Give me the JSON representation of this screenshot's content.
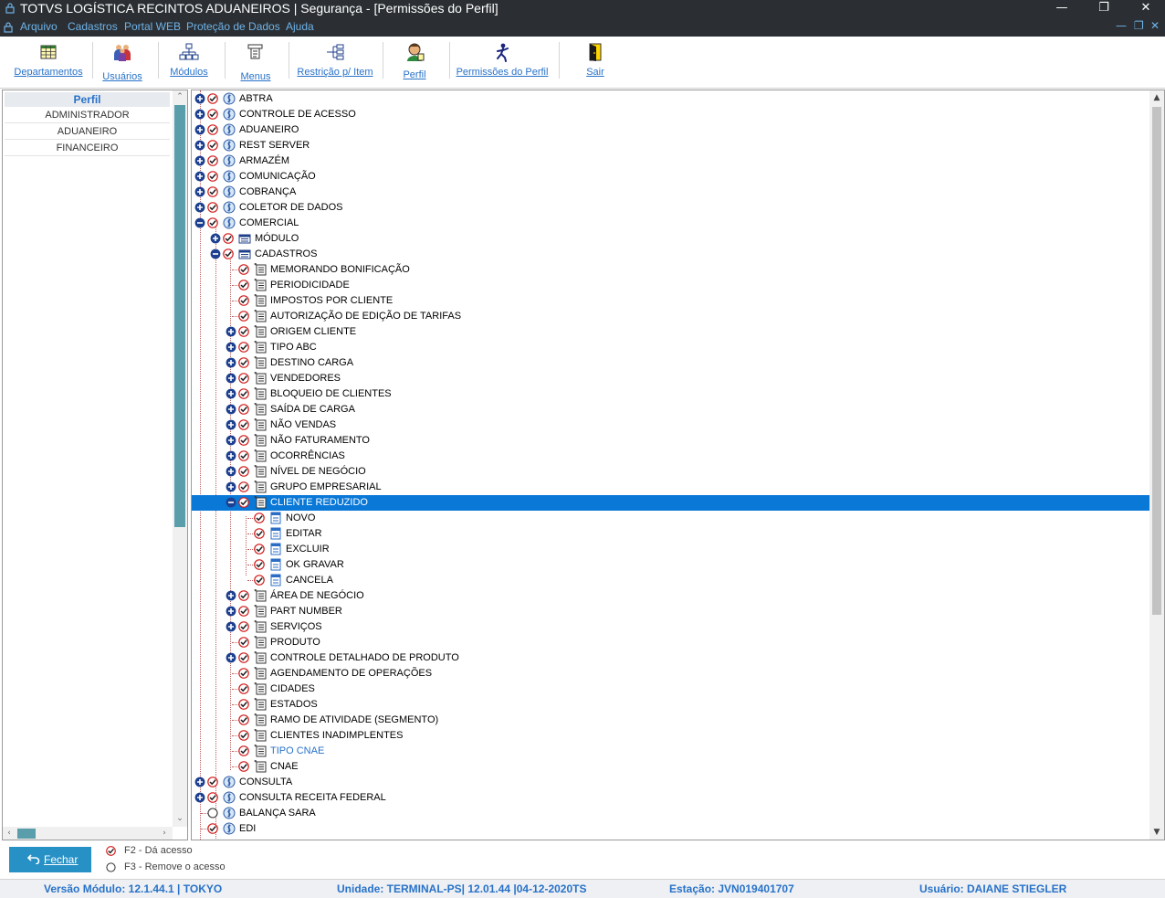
{
  "window": {
    "title": "TOTVS LOGÍSTICA RECINTOS ADUANEIROS | Segurança - [Permissões do Perfil]",
    "minimize": "—",
    "restore": "❐",
    "close": "✕"
  },
  "menu": {
    "items": [
      "Arquivo",
      "Cadastros",
      "Portal WEB",
      "Proteção de Dados",
      "Ajuda"
    ],
    "mdi_minimize": "—",
    "mdi_restore": "❐",
    "mdi_close": "✕"
  },
  "toolbar": {
    "buttons": [
      {
        "label": "Departamentos",
        "icon": "grid-icon"
      },
      {
        "label": "Usuários",
        "icon": "users-icon"
      },
      {
        "label": "Módulos",
        "icon": "hierarchy-icon"
      },
      {
        "label": "Menus",
        "icon": "menu-icon"
      },
      {
        "label": "Restrição p/ Item",
        "icon": "restriction-icon"
      },
      {
        "label": "Perfil",
        "icon": "profile-icon"
      },
      {
        "label": "Permissões do Perfil",
        "icon": "permissions-icon"
      },
      {
        "label": "Sair",
        "icon": "exit-icon"
      }
    ]
  },
  "profiles": {
    "header": "Perfil",
    "items": [
      "ADMINISTRADOR",
      "ADUANEIRO",
      "FINANCEIRO"
    ]
  },
  "tree": {
    "nodes": [
      {
        "label": "ABTRA",
        "level": 0,
        "expander": "plus",
        "check": "checked",
        "icon": "module"
      },
      {
        "label": "CONTROLE DE ACESSO",
        "level": 0,
        "expander": "plus",
        "check": "checked",
        "icon": "module"
      },
      {
        "label": "ADUANEIRO",
        "level": 0,
        "expander": "plus",
        "check": "checked",
        "icon": "module"
      },
      {
        "label": "REST SERVER",
        "level": 0,
        "expander": "plus",
        "check": "checked",
        "icon": "module"
      },
      {
        "label": "ARMAZÉM",
        "level": 0,
        "expander": "plus",
        "check": "checked",
        "icon": "module"
      },
      {
        "label": "COMUNICAÇÃO",
        "level": 0,
        "expander": "plus",
        "check": "checked",
        "icon": "module"
      },
      {
        "label": "COBRANÇA",
        "level": 0,
        "expander": "plus",
        "check": "checked",
        "icon": "module"
      },
      {
        "label": "COLETOR DE DADOS",
        "level": 0,
        "expander": "plus",
        "check": "checked",
        "icon": "module"
      },
      {
        "label": "COMERCIAL",
        "level": 0,
        "expander": "minus",
        "check": "checked",
        "icon": "module"
      },
      {
        "label": "MÓDULO",
        "level": 1,
        "expander": "plus",
        "check": "checked",
        "icon": "folder"
      },
      {
        "label": "CADASTROS",
        "level": 1,
        "expander": "minus",
        "check": "checked",
        "icon": "folder"
      },
      {
        "label": "MEMORANDO BONIFICAÇÃO",
        "level": 2,
        "expander": "none",
        "check": "checked",
        "icon": "form"
      },
      {
        "label": "PERIODICIDADE",
        "level": 2,
        "expander": "none",
        "check": "checked",
        "icon": "form"
      },
      {
        "label": "IMPOSTOS POR CLIENTE",
        "level": 2,
        "expander": "none",
        "check": "checked",
        "icon": "form"
      },
      {
        "label": "AUTORIZAÇÃO DE EDIÇÃO DE TARIFAS",
        "level": 2,
        "expander": "none",
        "check": "checked",
        "icon": "form"
      },
      {
        "label": "ORIGEM CLIENTE",
        "level": 2,
        "expander": "plus",
        "check": "checked",
        "icon": "form"
      },
      {
        "label": "TIPO ABC",
        "level": 2,
        "expander": "plus",
        "check": "checked",
        "icon": "form"
      },
      {
        "label": "DESTINO CARGA",
        "level": 2,
        "expander": "plus",
        "check": "checked",
        "icon": "form"
      },
      {
        "label": "VENDEDORES",
        "level": 2,
        "expander": "plus",
        "check": "checked",
        "icon": "form"
      },
      {
        "label": "BLOQUEIO DE CLIENTES",
        "level": 2,
        "expander": "plus",
        "check": "checked",
        "icon": "form"
      },
      {
        "label": "SAÍDA DE CARGA",
        "level": 2,
        "expander": "plus",
        "check": "checked",
        "icon": "form"
      },
      {
        "label": "NÃO VENDAS",
        "level": 2,
        "expander": "plus",
        "check": "checked",
        "icon": "form"
      },
      {
        "label": "NÃO FATURAMENTO",
        "level": 2,
        "expander": "plus",
        "check": "checked",
        "icon": "form"
      },
      {
        "label": "OCORRÊNCIAS",
        "level": 2,
        "expander": "plus",
        "check": "checked",
        "icon": "form"
      },
      {
        "label": "NÍVEL DE NEGÓCIO",
        "level": 2,
        "expander": "plus",
        "check": "checked",
        "icon": "form"
      },
      {
        "label": "GRUPO EMPRESARIAL",
        "level": 2,
        "expander": "plus",
        "check": "checked",
        "icon": "form"
      },
      {
        "label": "CLIENTE REDUZIDO",
        "level": 2,
        "expander": "minus",
        "check": "checked",
        "icon": "form",
        "selected": true
      },
      {
        "label": "NOVO",
        "level": 3,
        "expander": "none",
        "check": "checked",
        "icon": "action"
      },
      {
        "label": "EDITAR",
        "level": 3,
        "expander": "none",
        "check": "checked",
        "icon": "action"
      },
      {
        "label": "EXCLUIR",
        "level": 3,
        "expander": "none",
        "check": "checked",
        "icon": "action"
      },
      {
        "label": "OK GRAVAR",
        "level": 3,
        "expander": "none",
        "check": "checked",
        "icon": "action"
      },
      {
        "label": "CANCELA",
        "level": 3,
        "expander": "none",
        "check": "checked",
        "icon": "action"
      },
      {
        "label": "ÁREA DE NEGÓCIO",
        "level": 2,
        "expander": "plus",
        "check": "checked",
        "icon": "form"
      },
      {
        "label": "PART NUMBER",
        "level": 2,
        "expander": "plus",
        "check": "checked",
        "icon": "form"
      },
      {
        "label": "SERVIÇOS",
        "level": 2,
        "expander": "plus",
        "check": "checked",
        "icon": "form"
      },
      {
        "label": "PRODUTO",
        "level": 2,
        "expander": "none",
        "check": "checked",
        "icon": "form"
      },
      {
        "label": "CONTROLE DETALHADO DE PRODUTO",
        "level": 2,
        "expander": "plus",
        "check": "checked",
        "icon": "form"
      },
      {
        "label": "AGENDAMENTO DE OPERAÇÕES",
        "level": 2,
        "expander": "none",
        "check": "checked",
        "icon": "form"
      },
      {
        "label": "CIDADES",
        "level": 2,
        "expander": "none",
        "check": "checked",
        "icon": "form"
      },
      {
        "label": "ESTADOS",
        "level": 2,
        "expander": "none",
        "check": "checked",
        "icon": "form"
      },
      {
        "label": "RAMO DE ATIVIDADE (SEGMENTO)",
        "level": 2,
        "expander": "none",
        "check": "checked",
        "icon": "form"
      },
      {
        "label": "CLIENTES INADIMPLENTES",
        "level": 2,
        "expander": "none",
        "check": "checked",
        "icon": "form"
      },
      {
        "label": "TIPO CNAE",
        "level": 2,
        "expander": "none",
        "check": "checked",
        "icon": "form",
        "highlight": true
      },
      {
        "label": "CNAE",
        "level": 2,
        "expander": "none",
        "check": "checked",
        "icon": "form"
      },
      {
        "label": "CONSULTA",
        "level": 0,
        "expander": "plus",
        "check": "checked",
        "icon": "module"
      },
      {
        "label": "CONSULTA RECEITA FEDERAL",
        "level": 0,
        "expander": "plus",
        "check": "checked",
        "icon": "module"
      },
      {
        "label": "BALANÇA SARA",
        "level": 0,
        "expander": "none",
        "check": "unchecked",
        "icon": "module"
      },
      {
        "label": "EDI",
        "level": 0,
        "expander": "none",
        "check": "checked",
        "icon": "module"
      }
    ]
  },
  "footer": {
    "close_button": "Fechar",
    "legend_grant": "F2 - Dá acesso",
    "legend_remove": "F3 - Remove o acesso"
  },
  "status": {
    "version": "Versão Módulo:  12.1.44.1  |  TOKYO",
    "unit": "Unidade:  TERMINAL-PS| 12.01.44 |04-12-2020TS",
    "station": "Estação:  JVN019401707",
    "user": "Usuário:  DAIANE STIEGLER"
  },
  "colors": {
    "titlebar": "#2b2f33",
    "menu_text": "#6fb3e8",
    "link_blue": "#2872c9",
    "selection": "#0a78d7",
    "check_red": "#d21b1b",
    "button": "#2791c6"
  }
}
